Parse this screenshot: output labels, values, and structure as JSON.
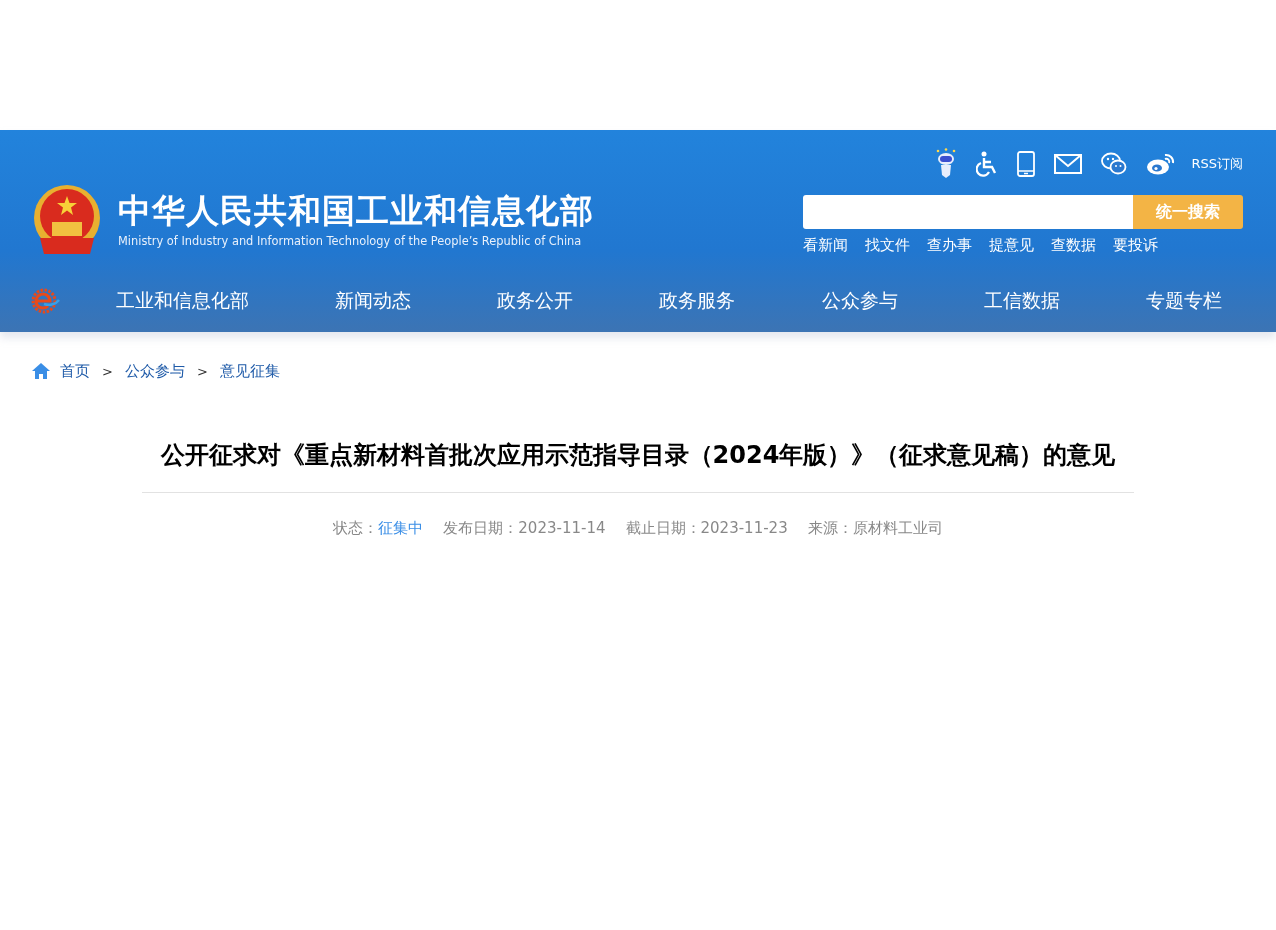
{
  "header": {
    "site_title": "中华人民共和国工业和信息化部",
    "site_subtitle": "Ministry of Industry and Information Technology of the People’s Republic of China",
    "tools": [
      {
        "kind": "robot"
      },
      {
        "kind": "accessibility"
      },
      {
        "kind": "mobile"
      },
      {
        "kind": "mail"
      },
      {
        "kind": "wechat"
      },
      {
        "kind": "weibo"
      }
    ],
    "rss": "RSS订阅",
    "search": {
      "button": "统一搜索"
    },
    "quick_links": [
      "看新闻",
      "找文件",
      "查办事",
      "提意见",
      "查数据",
      "要投诉"
    ],
    "nav": [
      "工业和信息化部",
      "新闻动态",
      "政务公开",
      "政务服务",
      "公众参与",
      "工信数据",
      "专题专栏"
    ]
  },
  "breadcrumb": {
    "items": [
      "首页",
      "公众参与",
      "意见征集"
    ],
    "separators": [
      ">",
      ">"
    ]
  },
  "article": {
    "title": "公开征求对《重点新材料首批次应用示范指导目录（2024年版）》（征求意见稿）的意见",
    "meta": [
      {
        "label": "状态：",
        "value": "征集中",
        "kind": "status"
      },
      {
        "label": "发布日期：",
        "value": "2023-11-14",
        "kind": "plain"
      },
      {
        "label": "截止日期：",
        "value": "2023-11-23",
        "kind": "plain"
      },
      {
        "label": "来源：",
        "value": "原材料工业司",
        "kind": "plain"
      }
    ]
  }
}
